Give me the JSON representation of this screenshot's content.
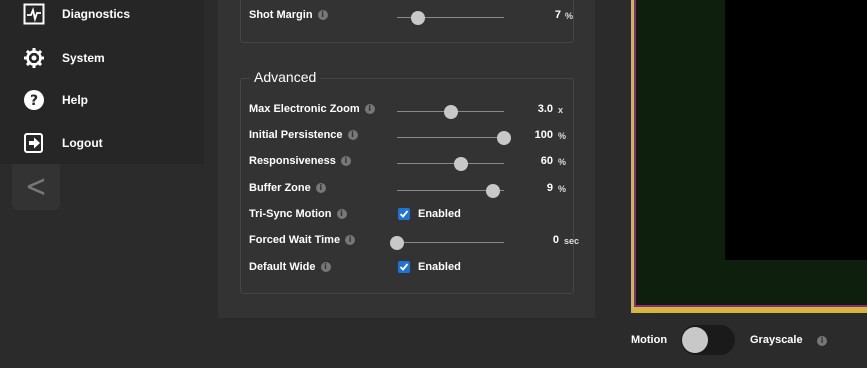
{
  "sidebar": {
    "items": [
      {
        "label": "Diagnostics",
        "icon": "diagnostics-icon"
      },
      {
        "label": "System",
        "icon": "gear-icon"
      },
      {
        "label": "Help",
        "icon": "help-icon"
      },
      {
        "label": "Logout",
        "icon": "logout-icon"
      }
    ],
    "collapse_glyph": "<"
  },
  "settings": {
    "shot_margin": {
      "label": "Shot Margin",
      "value": "7",
      "unit": "%",
      "level": 0.2
    },
    "advanced": {
      "title": "Advanced",
      "max_zoom": {
        "label": "Max Electronic Zoom",
        "value": "3.0",
        "unit": "x",
        "level": 0.5
      },
      "initial_persistence": {
        "label": "Initial Persistence",
        "value": "100",
        "unit": "%",
        "level": 1.0
      },
      "responsiveness": {
        "label": "Responsiveness",
        "value": "60",
        "unit": "%",
        "level": 0.6
      },
      "buffer_zone": {
        "label": "Buffer Zone",
        "value": "9",
        "unit": "%",
        "level": 0.9
      },
      "tri_sync": {
        "label": "Tri-Sync Motion",
        "checkbox_label": "Enabled",
        "checked": true
      },
      "forced_wait": {
        "label": "Forced Wait Time",
        "value": "0",
        "unit": "sec",
        "level": 0.0
      },
      "default_wide": {
        "label": "Default Wide",
        "checkbox_label": "Enabled",
        "checked": true
      }
    }
  },
  "video": {
    "motion_label": "Motion",
    "grayscale_label": "Grayscale",
    "motion_enabled": false
  },
  "colors": {
    "accent_blue": "#1e73d6",
    "frame_yellow": "#d4b73c",
    "frame_purple": "#8a2b82"
  }
}
